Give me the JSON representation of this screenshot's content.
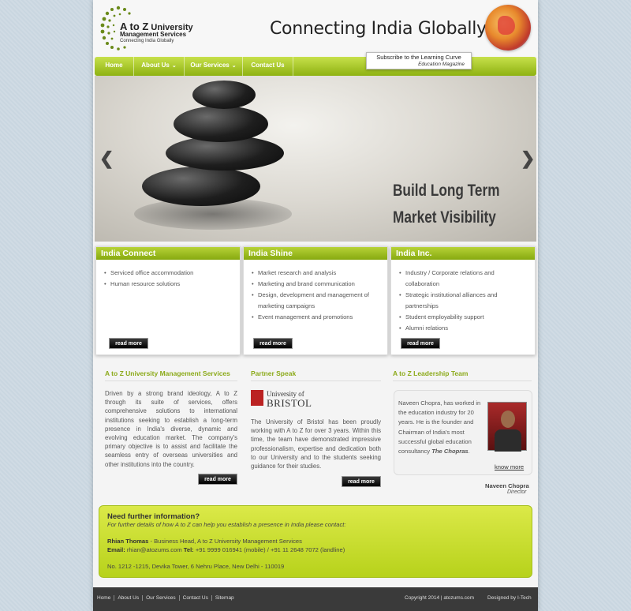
{
  "brand": {
    "logo_line1": "A to Z",
    "logo_line1b": "University",
    "logo_line2": "Management Services",
    "logo_line3": "Connecting India Globally",
    "tagline": "Connecting India Globally",
    "globe_icon": "globe-icon"
  },
  "nav": {
    "items": [
      {
        "label": "Home"
      },
      {
        "label": "About Us"
      },
      {
        "label": "Our Services"
      },
      {
        "label": "Contact Us"
      }
    ],
    "subscribe_line1": "Subscribe to the Learning Curve",
    "subscribe_line2": "Education Magazine"
  },
  "slider": {
    "line1": "Build Long Term",
    "line2": "Market Visibility",
    "prev_icon": "chevron-left-icon",
    "next_icon": "chevron-right-icon"
  },
  "boxes": [
    {
      "title": "India Connect",
      "items": [
        "Serviced office accommodation",
        "Human resource solutions"
      ],
      "button": "read more"
    },
    {
      "title": "India Shine",
      "items": [
        "Market research and analysis",
        "Marketing and brand communication",
        "Design, development and management of marketing campaigns",
        "Event management and promotions"
      ],
      "button": "read more"
    },
    {
      "title": "India Inc.",
      "items": [
        "Industry / Corporate relations and collaboration",
        "Strategic institutional alliances and partnerships",
        "Student employability support",
        "Alumni relations"
      ],
      "button": "read more"
    }
  ],
  "sections": {
    "atoz": {
      "title": "A to Z University Management Services",
      "text": "Driven by a strong brand ideology, A to Z through its suite of services, offers comprehensive solutions to international institutions seeking to establish a long-term presence in India's diverse, dynamic and evolving education market. The company's primary objective is to assist and facilitate the seamless entry of overseas universities and other institutions into the country.",
      "button": "read more"
    },
    "partner": {
      "title": "Partner Speak",
      "logo_line1": "University of",
      "logo_line2": "BRISTOL",
      "text": "The University of Bristol has been proudly working with A to Z for over 3 years. Within this time, the team have demonstrated impressive professionalism, expertise and dedication both to our University and to the students seeking guidance for their studies.",
      "button": "read more"
    },
    "leadership": {
      "title": "A to Z Leadership Team",
      "text": "Naveen Chopra, has worked in the education industry for 20 years. He is the founder and Chairman of India's most successful global education consultancy",
      "text_em": "The Chopras",
      "know_more": "know more",
      "name": "Naveen Chopra",
      "role": "Director"
    }
  },
  "contact": {
    "heading": "Need further information?",
    "sub": "For further details of how A to Z can help you establish a presence in India please contact:",
    "person_name": "Rhian Thomas",
    "person_role": " - Business Head, A to Z University Management Services",
    "email_label": "Email:",
    "email": " rhian@atozums.com ",
    "tel_label": "Tel:",
    "tel": " +91 9999 016941 (mobile) / +91 11 2648 7072 (landline)",
    "address": "No. 1212 -1215, Devika Tower, 6 Nehru Place, New Delhi - 110019"
  },
  "footer": {
    "links": [
      "Home",
      "About Us",
      "Our Services",
      "Contact Us",
      "Sitemap"
    ],
    "copyright": "Copyright 2014 | atozums.com",
    "designed": "Designed by I-Tech"
  }
}
